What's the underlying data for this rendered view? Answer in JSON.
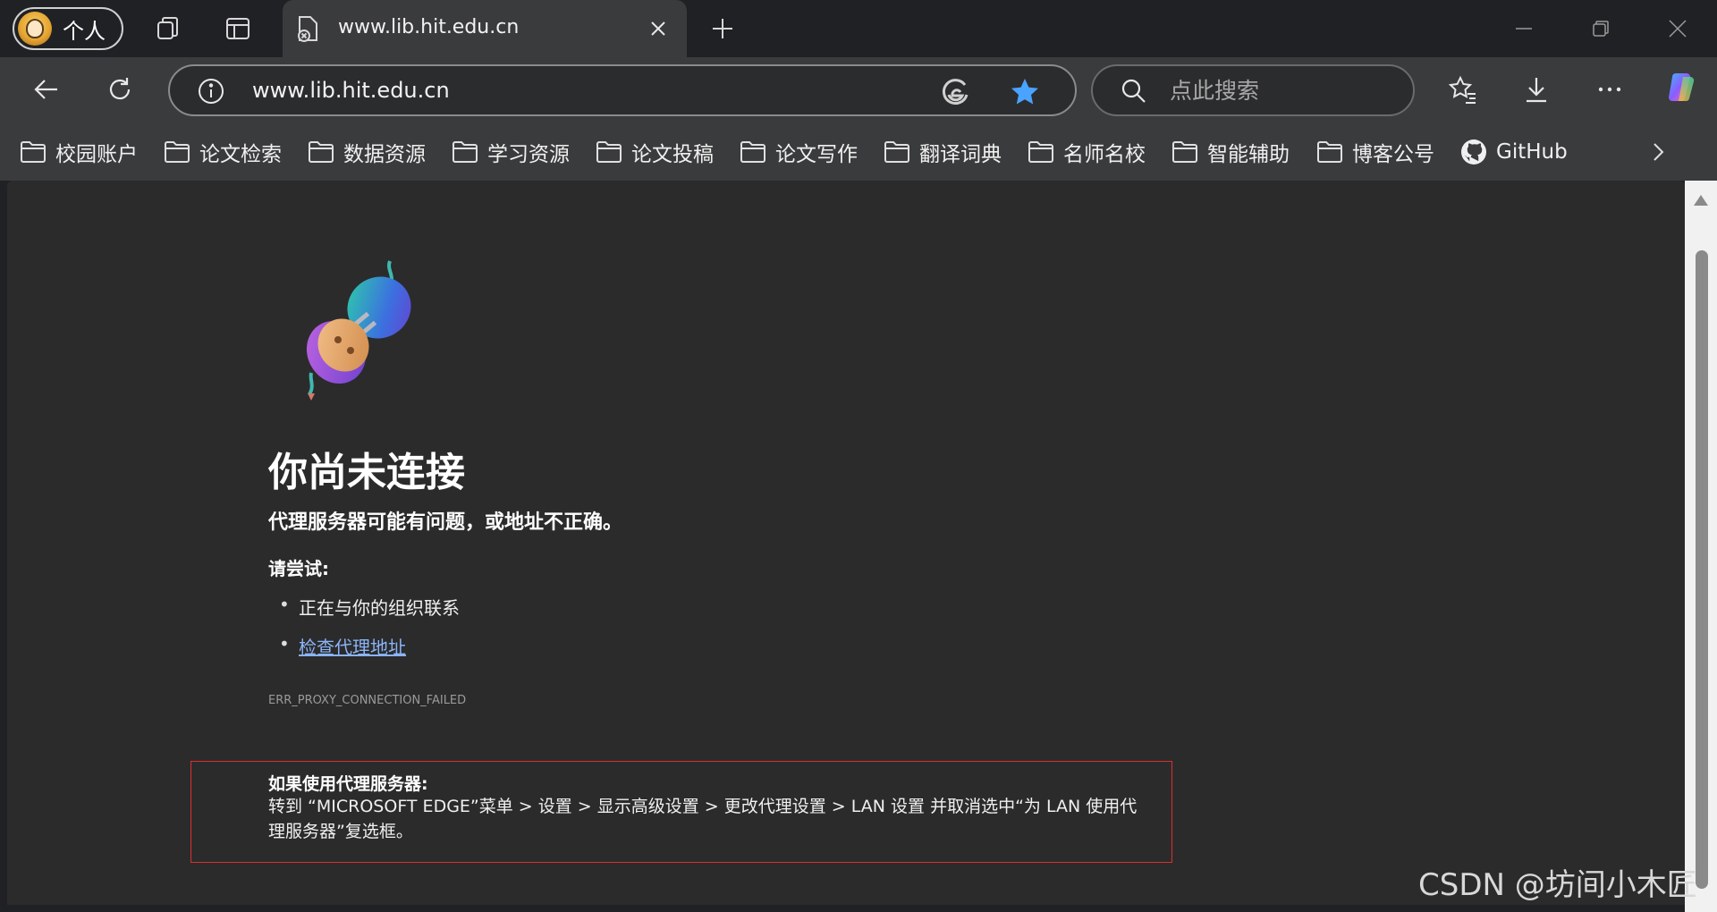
{
  "browser": {
    "profile_label": "个人",
    "active_tab_title": "www.lib.hit.edu.cn",
    "url": "www.lib.hit.edu.cn",
    "search_placeholder": "点此搜索"
  },
  "favorites": [
    {
      "label": "校园账户",
      "icon": "folder-icon"
    },
    {
      "label": "论文检索",
      "icon": "folder-icon"
    },
    {
      "label": "数据资源",
      "icon": "folder-icon"
    },
    {
      "label": "学习资源",
      "icon": "folder-icon"
    },
    {
      "label": "论文投稿",
      "icon": "folder-icon"
    },
    {
      "label": "论文写作",
      "icon": "folder-icon"
    },
    {
      "label": "翻译词典",
      "icon": "folder-icon"
    },
    {
      "label": "名师名校",
      "icon": "folder-icon"
    },
    {
      "label": "智能辅助",
      "icon": "folder-icon"
    },
    {
      "label": "博客公号",
      "icon": "folder-icon"
    },
    {
      "label": "GitHub",
      "icon": "github-icon"
    }
  ],
  "error": {
    "title": "你尚未连接",
    "subtitle": "代理服务器可能有问题，或地址不正确。",
    "try_label": "请尝试:",
    "suggestions": [
      "正在与你的组织联系",
      "检查代理地址"
    ],
    "code": "ERR_PROXY_CONNECTION_FAILED",
    "proxy_heading": "如果使用代理服务器:",
    "proxy_body": "转到 “MICROSOFT EDGE”菜单 > 设置 > 显示高级设置 > 更改代理设置 > LAN 设置 并取消选中“为 LAN 使用代理服务器”复选框。"
  },
  "watermark": "CSDN @坊间小木匠",
  "colors": {
    "accent_star": "#4aa3ff",
    "link": "#8ab4f8",
    "box_border": "#d9302f"
  }
}
